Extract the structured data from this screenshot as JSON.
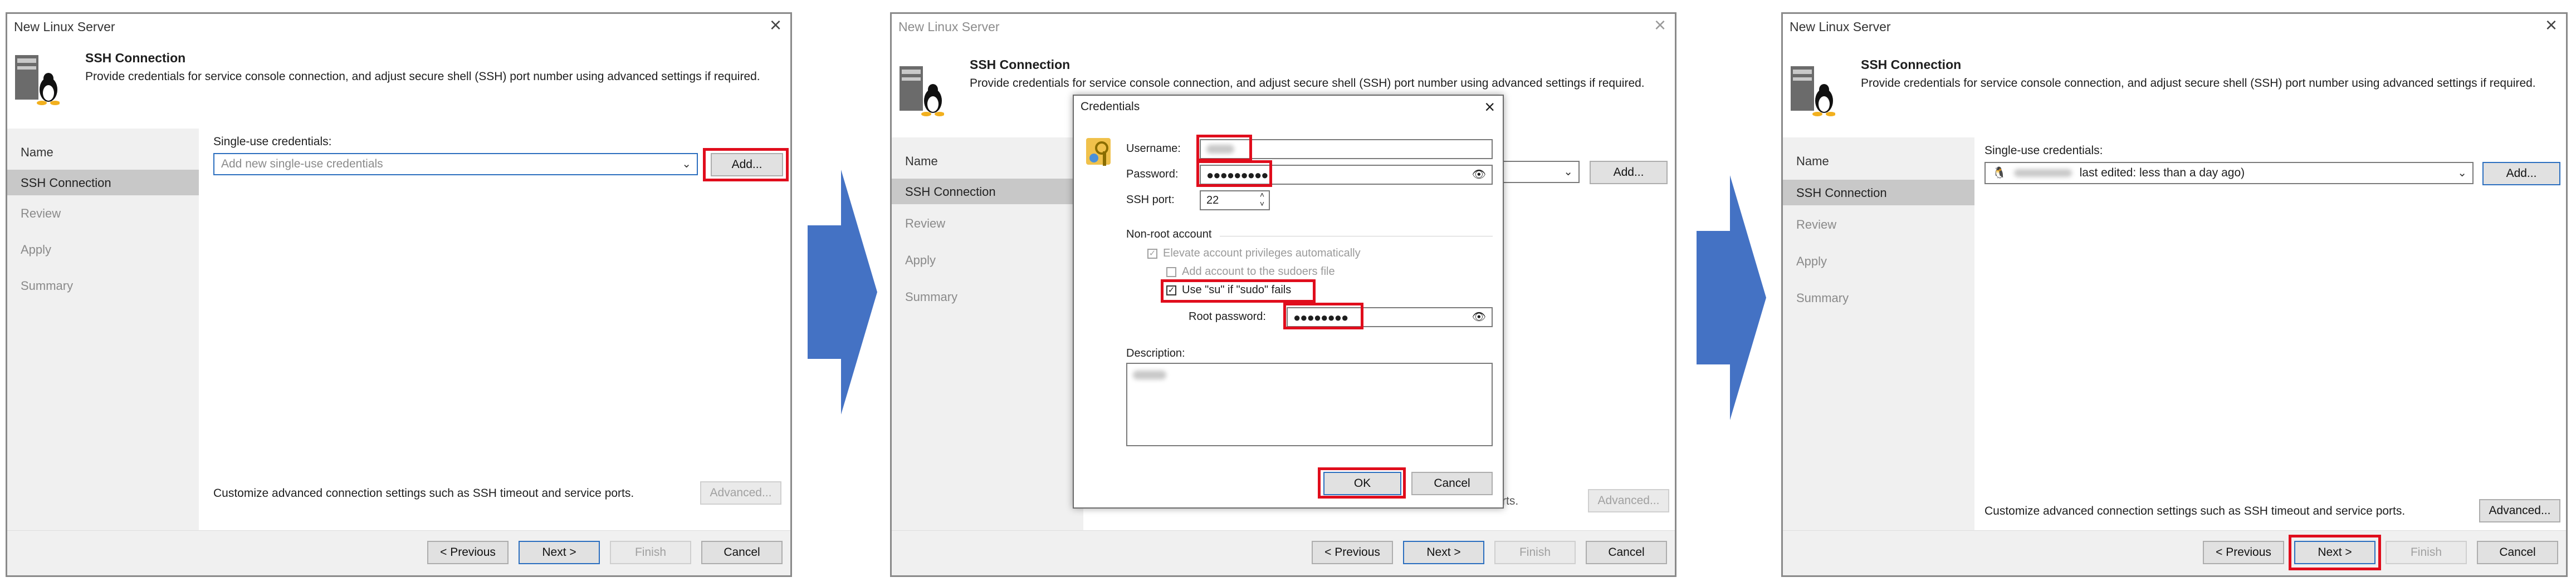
{
  "window_title": "New Linux Server",
  "header": {
    "title": "SSH Connection",
    "description": "Provide credentials for service console connection, and adjust secure shell (SSH) port number using advanced settings if required."
  },
  "nav": [
    "Name",
    "SSH Connection",
    "Review",
    "Apply",
    "Summary"
  ],
  "credentials_label": "Single-use credentials:",
  "credentials_placeholder": "Add new single-use credentials",
  "credentials_selected_suffix": "last edited: less than a day ago)",
  "add_button": "Add...",
  "advanced_text": "Customize advanced connection settings such as SSH timeout and service ports.",
  "advanced_button": "Advanced...",
  "footer_buttons": {
    "previous": "< Previous",
    "next": "Next >",
    "finish": "Finish",
    "cancel": "Cancel"
  },
  "dialog": {
    "title": "Credentials",
    "username_label": "Username:",
    "password_label": "Password:",
    "password_mask": "●●●●●●●●●",
    "ssh_port_label": "SSH port:",
    "ssh_port_value": "22",
    "nonroot_section": "Non-root account",
    "elevate_label": "Elevate account privileges automatically",
    "sudoers_label": "Add account to the sudoers file",
    "use_su_label": "Use \"su\" if \"sudo\" fails",
    "root_password_label": "Root password:",
    "root_password_mask": "●●●●●●●●",
    "description_label": "Description:",
    "ok": "OK",
    "cancel": "Cancel"
  },
  "colors": {
    "highlight_red": "#e00d1c",
    "arrow_blue": "#4472c4",
    "nav_selected": "#c8c8c8"
  }
}
